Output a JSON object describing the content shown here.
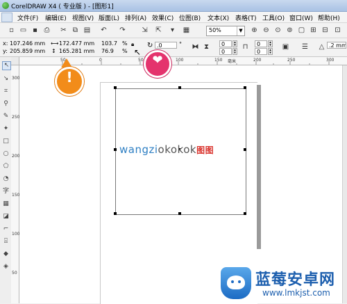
{
  "window": {
    "title": "CorelDRAW X4 ( 专业版 ) - [图形1]"
  },
  "menu": {
    "items": [
      "文件(F)",
      "编辑(E)",
      "视图(V)",
      "版面(L)",
      "排列(A)",
      "效果(C)",
      "位图(B)",
      "文本(X)",
      "表格(T)",
      "工具(O)",
      "窗口(W)",
      "帮助(H)"
    ]
  },
  "toolbar": {
    "zoom_value": "50%"
  },
  "propbar": {
    "x_label": "x:",
    "x_value": "107.246 mm",
    "y_label": "y:",
    "y_value": "205.859 mm",
    "width_value": "172.477 mm",
    "height_value": "165.281 mm",
    "scale_x": "103.7",
    "scale_y": "76.9",
    "percent_sign": "%",
    "rotation_value": ".0",
    "degree_sign": "°",
    "field_zero_a": "0",
    "field_zero_b": "0",
    "field_zero_c": "0",
    "field_zero_d": "0",
    "outline_value": ".2 mm"
  },
  "ruler": {
    "top_labels": [
      "50",
      "0",
      "50",
      "100",
      "150",
      "200",
      "250",
      "300"
    ],
    "unit": "毫米",
    "left_labels": [
      "300",
      "250",
      "200",
      "150",
      "100",
      "50"
    ]
  },
  "canvas": {
    "logo_blue": "wangzi",
    "logo_gray": "okokok",
    "logo_red": "图图"
  },
  "watermark": {
    "title": "蓝莓安卓网",
    "url": "www.lmkjst.com"
  },
  "colors": {
    "accent_orange": "#f28c1a",
    "accent_pink": "#e4336d",
    "logo_blue": "#2e7fc3",
    "watermark_blue": "#1d5fae"
  }
}
